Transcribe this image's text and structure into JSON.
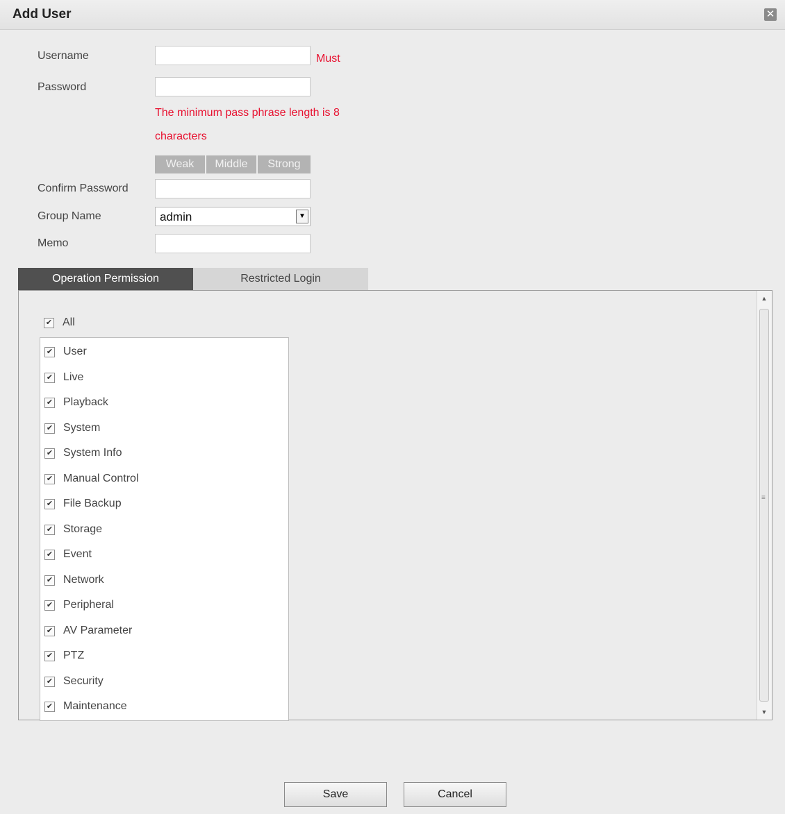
{
  "dialog": {
    "title": "Add User",
    "close_icon": "close-icon"
  },
  "form": {
    "username_label": "Username",
    "username_value": "",
    "must_label": "Must",
    "password_label": "Password",
    "password_value": "",
    "hint_line1": "The minimum pass phrase length is 8",
    "hint_line2": "characters",
    "strength": [
      "Weak",
      "Middle",
      "Strong"
    ],
    "confirm_label": "Confirm Password",
    "confirm_value": "",
    "group_label": "Group Name",
    "group_value": "admin",
    "memo_label": "Memo",
    "memo_value": ""
  },
  "tabs": [
    {
      "label": "Operation Permission",
      "active": true
    },
    {
      "label": "Restricted Login",
      "active": false
    }
  ],
  "permissions": {
    "all_label": "All",
    "all_checked": true,
    "items": [
      {
        "label": "User",
        "checked": true
      },
      {
        "label": "Live",
        "checked": true
      },
      {
        "label": "Playback",
        "checked": true
      },
      {
        "label": "System",
        "checked": true
      },
      {
        "label": "System Info",
        "checked": true
      },
      {
        "label": "Manual Control",
        "checked": true
      },
      {
        "label": "File Backup",
        "checked": true
      },
      {
        "label": "Storage",
        "checked": true
      },
      {
        "label": "Event",
        "checked": true
      },
      {
        "label": "Network",
        "checked": true
      },
      {
        "label": "Peripheral",
        "checked": true
      },
      {
        "label": "AV Parameter",
        "checked": true
      },
      {
        "label": "PTZ",
        "checked": true
      },
      {
        "label": "Security",
        "checked": true
      },
      {
        "label": "Maintenance",
        "checked": true
      }
    ]
  },
  "buttons": {
    "save": "Save",
    "cancel": "Cancel"
  },
  "colors": {
    "error": "#e8102f",
    "active_tab": "#505050"
  }
}
